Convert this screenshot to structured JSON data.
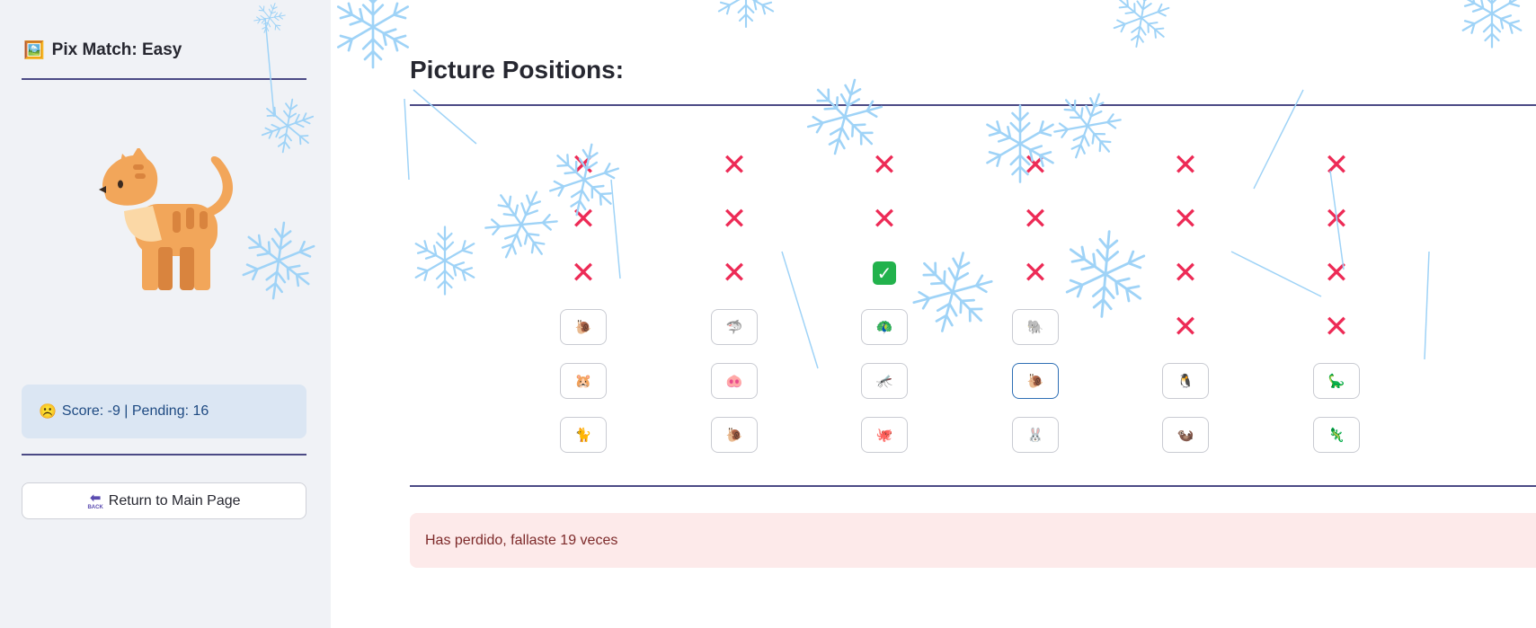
{
  "sidebar": {
    "title_icon": "🖼️",
    "title": "Pix Match: Easy",
    "mascot": "cat-illustration",
    "score_emoji": "☹️",
    "score_text": "Score: -9 | Pending: 16",
    "return_button": "Return to Main Page",
    "return_icon_text": "BACK"
  },
  "main": {
    "title": "Picture Positions:",
    "message": "Has perdido, fallaste 19 veces"
  },
  "board": {
    "rows": [
      [
        {
          "type": "x"
        },
        {
          "type": "x"
        },
        {
          "type": "x"
        },
        {
          "type": "x"
        },
        {
          "type": "x"
        },
        {
          "type": "x"
        }
      ],
      [
        {
          "type": "x"
        },
        {
          "type": "x"
        },
        {
          "type": "x"
        },
        {
          "type": "x"
        },
        {
          "type": "x"
        },
        {
          "type": "x"
        }
      ],
      [
        {
          "type": "x"
        },
        {
          "type": "x"
        },
        {
          "type": "check"
        },
        {
          "type": "x"
        },
        {
          "type": "x"
        },
        {
          "type": "x"
        }
      ],
      [
        {
          "type": "pic",
          "emoji": "🐌"
        },
        {
          "type": "pic",
          "emoji": "🦈"
        },
        {
          "type": "pic",
          "emoji": "🦚"
        },
        {
          "type": "pic",
          "emoji": "🐘"
        },
        {
          "type": "x"
        },
        {
          "type": "x"
        }
      ],
      [
        {
          "type": "pic",
          "emoji": "🐹"
        },
        {
          "type": "pic",
          "emoji": "🐽"
        },
        {
          "type": "pic",
          "emoji": "🦟"
        },
        {
          "type": "pic",
          "emoji": "🐌",
          "active": true
        },
        {
          "type": "pic",
          "emoji": "🐧"
        },
        {
          "type": "pic",
          "emoji": "🦕"
        }
      ],
      [
        {
          "type": "pic",
          "emoji": "🐈"
        },
        {
          "type": "pic",
          "emoji": "🐌"
        },
        {
          "type": "pic",
          "emoji": "🐙"
        },
        {
          "type": "pic",
          "emoji": "🐰"
        },
        {
          "type": "pic",
          "emoji": "🦦"
        },
        {
          "type": "pic",
          "emoji": "🦎"
        }
      ]
    ],
    "x_symbol": "✕",
    "check_symbol": "✓"
  },
  "colors": {
    "accent_line": "#4b4a85",
    "x_mark": "#ed2b56",
    "check_mark": "#22b24c",
    "info_bg": "#dbe6f3",
    "error_bg": "#fdeaea",
    "snowflake": "#9fd3f7"
  }
}
